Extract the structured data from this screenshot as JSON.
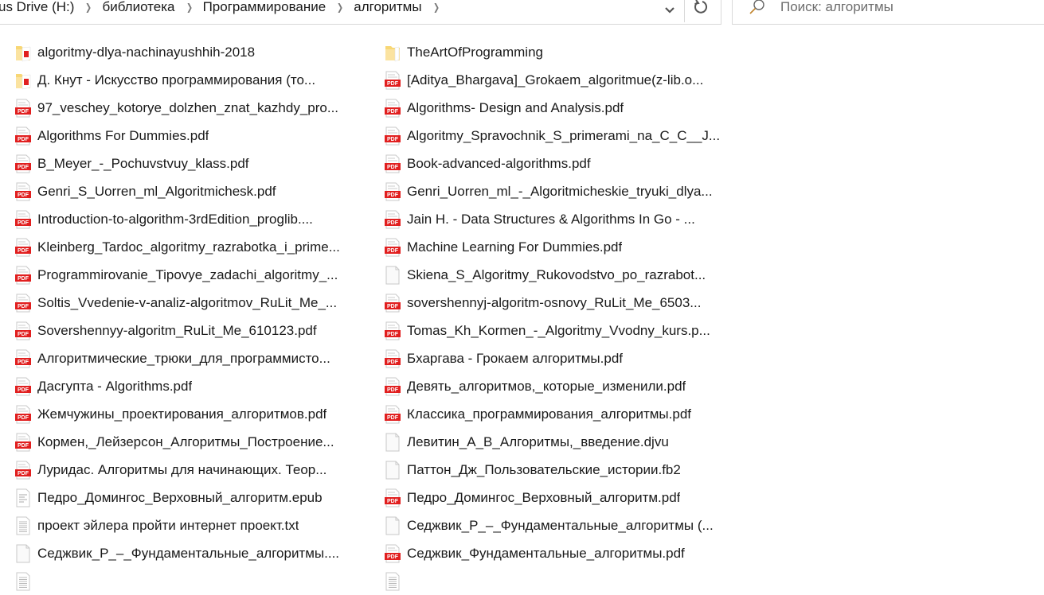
{
  "window": {
    "title": "алгоритмы"
  },
  "breadcrumb": [
    {
      "label": "us Drive (H:)"
    },
    {
      "label": "библиотека"
    },
    {
      "label": "Программирование"
    },
    {
      "label": "алгоритмы"
    }
  ],
  "address_bar": {
    "dropdown_icon": "chevron-down-icon",
    "refresh_icon": "refresh-icon"
  },
  "search": {
    "placeholder": "Поиск: алгоритмы",
    "value": "",
    "icon": "search-icon"
  },
  "colors": {
    "folder": "#f5c84a",
    "pdf_red": "#e11f1f",
    "border": "#d9d9d9"
  },
  "files": {
    "column1": [
      {
        "name": "algoritmy-dlya-nachinayushhih-2018",
        "type": "folder-pdf"
      },
      {
        "name": "Д. Кнут -  Искусство программирования (то...",
        "type": "folder-pdf"
      },
      {
        "name": "97_veschey_kotorye_dolzhen_znat_kazhdy_pro...",
        "type": "pdf"
      },
      {
        "name": "Algorithms For Dummies.pdf",
        "type": "pdf"
      },
      {
        "name": "B_Meyer_-_Pochuvstvuy_klass.pdf",
        "type": "pdf"
      },
      {
        "name": "Genri_S_Uorren_ml_Algoritmichesk.pdf",
        "type": "pdf"
      },
      {
        "name": "Introduction-to-algorithm-3rdEdition_proglib....",
        "type": "pdf"
      },
      {
        "name": "Kleinberg_Tardoc_algoritmy_razrabotka_i_prime...",
        "type": "pdf"
      },
      {
        "name": "Programmirovanie_Tipovye_zadachi_algoritmy_...",
        "type": "pdf"
      },
      {
        "name": "Soltis_Vvedenie-v-analiz-algoritmov_RuLit_Me_...",
        "type": "pdf"
      },
      {
        "name": "Sovershennyy-algoritm_RuLit_Me_610123.pdf",
        "type": "pdf"
      },
      {
        "name": "Алгоритмические_трюки_для_программисто...",
        "type": "pdf"
      },
      {
        "name": "Дасгупта - Algorithms.pdf",
        "type": "pdf"
      },
      {
        "name": "Жемчужины_проектирования_алгоритмов.pdf",
        "type": "pdf"
      },
      {
        "name": "Кормен,_Лейзерсон_Алгоритмы_Построение...",
        "type": "pdf"
      },
      {
        "name": "Луридас. Алгоритмы для начинающих. Теор...",
        "type": "pdf"
      },
      {
        "name": "Педро_Домингос_Верховный_алгоритм.epub",
        "type": "epub"
      },
      {
        "name": "проект эйлера пройти интернет проект.txt",
        "type": "txt"
      },
      {
        "name": "Седжвик_Р_–_Фундаментальные_алгоритмы....",
        "type": "generic"
      },
      {
        "name": "",
        "type": "txt"
      }
    ],
    "column2": [
      {
        "name": "TheArtOfProgramming",
        "type": "folder"
      },
      {
        "name": "[Aditya_Bhargava]_Grokaem_algoritmue(z-lib.o...",
        "type": "pdf"
      },
      {
        "name": "Algorithms- Design and Analysis.pdf",
        "type": "pdf"
      },
      {
        "name": "Algoritmy_Spravochnik_S_primerami_na_C_C__J...",
        "type": "pdf"
      },
      {
        "name": "Book-advanced-algorithms.pdf",
        "type": "pdf"
      },
      {
        "name": "Genri_Uorren_ml_-_Algoritmicheskie_tryuki_dlya...",
        "type": "pdf"
      },
      {
        "name": "Jain H. - Data Structures & Algorithms In Go - ...",
        "type": "pdf"
      },
      {
        "name": "Machine Learning For Dummies.pdf",
        "type": "pdf"
      },
      {
        "name": "Skiena_S_Algoritmy_Rukovodstvo_po_razrabot...",
        "type": "generic"
      },
      {
        "name": "sovershennyj-algoritm-osnovy_RuLit_Me_6503...",
        "type": "pdf"
      },
      {
        "name": "Tomas_Kh_Kormen_-_Algoritmy_Vvodny_kurs.p...",
        "type": "pdf"
      },
      {
        "name": "Бхаргава - Грокаем алгоритмы.pdf",
        "type": "pdf"
      },
      {
        "name": "Девять_алгоритмов,_которые_изменили.pdf",
        "type": "pdf"
      },
      {
        "name": "Классика_программирования_алгоритмы.pdf",
        "type": "pdf"
      },
      {
        "name": "Левитин_А_В_Алгоритмы,_введение.djvu",
        "type": "generic"
      },
      {
        "name": "Паттон_Дж_Пользовательские_истории.fb2",
        "type": "generic"
      },
      {
        "name": "Педро_Домингос_Верховный_алгоритм.pdf",
        "type": "pdf"
      },
      {
        "name": "Седжвик_Р_–_Фундаментальные_алгоритмы (...",
        "type": "generic"
      },
      {
        "name": "Седжвик_Фундаментальные_алгоритмы.pdf",
        "type": "pdf"
      },
      {
        "name": "",
        "type": "txt"
      }
    ]
  }
}
